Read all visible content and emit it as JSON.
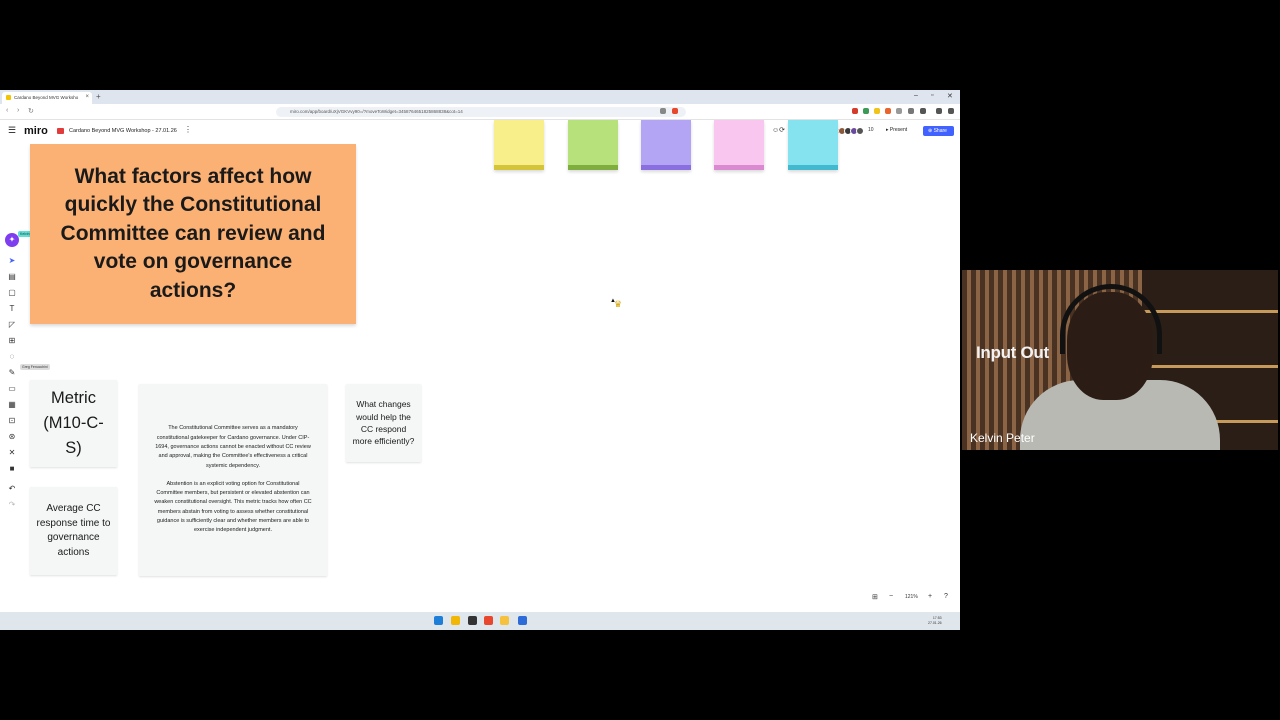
{
  "browser": {
    "tab_title": "Cardano Beyond MVG Worksho",
    "url": "miro.com/app/board/uXjVGKVvy90=/?moveToWidget=3458764651825868838&cot=14"
  },
  "toolbar": {
    "logo": "miro",
    "board_name": "Cardano Beyond MVG Workshop - 27.01.26",
    "participant_count": "10",
    "present_label": "Present",
    "share_label": "Share"
  },
  "canvas": {
    "question": "What factors affect how quickly the Constitutional Committee can review and vote on governance actions?",
    "metric": "Metric (M10-C-S)",
    "average_card": "Average CC response time to governance actions",
    "description_p1": "The Constitutional Committee serves as a mandatory constitutional gatekeeper for Cardano governance. Under CIP-1694, governance actions cannot be enacted without CC review and approval, making the Committee's effectiveness a critical systemic dependency.",
    "description_p2": "Abstention is an explicit voting option for Constitutional Committee members, but persistent or elevated abstention can weaken constitutional oversight. This metric tracks how often CC members abstain from voting to assess whether constitutional guidance is sufficiently clear and whether members are able to exercise independent judgment.",
    "changes_card": "What changes would help the CC respond more efficiently?",
    "cursor_label_1": "Kelvin Peter",
    "cursor_label_2": "Greg Fenucchini",
    "zoom": "121%",
    "sticky_colors": [
      "#f8ef8a",
      "#b7e27b",
      "#b3a4f4",
      "#f9c6ef",
      "#84e3ef"
    ]
  },
  "taskbar": {
    "time": "17:53",
    "date": "27.01.26"
  },
  "webcam": {
    "overlay_text": "Input Out",
    "name": "Kelvin Peter"
  }
}
